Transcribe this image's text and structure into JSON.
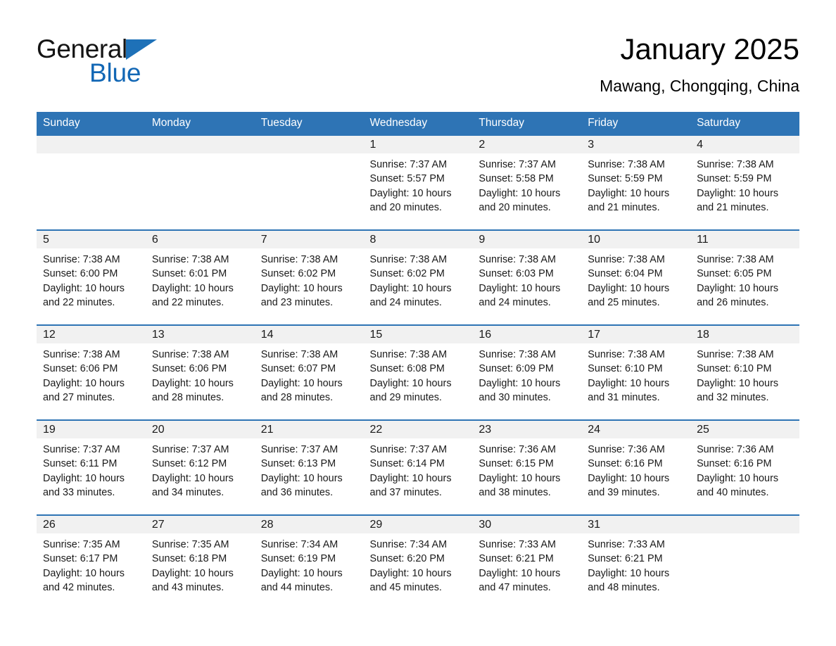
{
  "brand": {
    "name_part1": "General",
    "name_part2": "Blue",
    "triangle_color": "#1e71b8",
    "blue_color": "#1267b5"
  },
  "header": {
    "title": "January 2025",
    "location": "Mawang, Chongqing, China"
  },
  "theme": {
    "header_blue": "#2e74b5",
    "daynum_bg": "#f1f1f1",
    "text": "#1a1a1a"
  },
  "weekday_headers": [
    "Sunday",
    "Monday",
    "Tuesday",
    "Wednesday",
    "Thursday",
    "Friday",
    "Saturday"
  ],
  "weeks": [
    [
      {
        "day": "",
        "sunrise": "",
        "sunset": "",
        "daylight_line1": "",
        "daylight_line2": ""
      },
      {
        "day": "",
        "sunrise": "",
        "sunset": "",
        "daylight_line1": "",
        "daylight_line2": ""
      },
      {
        "day": "",
        "sunrise": "",
        "sunset": "",
        "daylight_line1": "",
        "daylight_line2": ""
      },
      {
        "day": "1",
        "sunrise": "Sunrise: 7:37 AM",
        "sunset": "Sunset: 5:57 PM",
        "daylight_line1": "Daylight: 10 hours",
        "daylight_line2": "and 20 minutes."
      },
      {
        "day": "2",
        "sunrise": "Sunrise: 7:37 AM",
        "sunset": "Sunset: 5:58 PM",
        "daylight_line1": "Daylight: 10 hours",
        "daylight_line2": "and 20 minutes."
      },
      {
        "day": "3",
        "sunrise": "Sunrise: 7:38 AM",
        "sunset": "Sunset: 5:59 PM",
        "daylight_line1": "Daylight: 10 hours",
        "daylight_line2": "and 21 minutes."
      },
      {
        "day": "4",
        "sunrise": "Sunrise: 7:38 AM",
        "sunset": "Sunset: 5:59 PM",
        "daylight_line1": "Daylight: 10 hours",
        "daylight_line2": "and 21 minutes."
      }
    ],
    [
      {
        "day": "5",
        "sunrise": "Sunrise: 7:38 AM",
        "sunset": "Sunset: 6:00 PM",
        "daylight_line1": "Daylight: 10 hours",
        "daylight_line2": "and 22 minutes."
      },
      {
        "day": "6",
        "sunrise": "Sunrise: 7:38 AM",
        "sunset": "Sunset: 6:01 PM",
        "daylight_line1": "Daylight: 10 hours",
        "daylight_line2": "and 22 minutes."
      },
      {
        "day": "7",
        "sunrise": "Sunrise: 7:38 AM",
        "sunset": "Sunset: 6:02 PM",
        "daylight_line1": "Daylight: 10 hours",
        "daylight_line2": "and 23 minutes."
      },
      {
        "day": "8",
        "sunrise": "Sunrise: 7:38 AM",
        "sunset": "Sunset: 6:02 PM",
        "daylight_line1": "Daylight: 10 hours",
        "daylight_line2": "and 24 minutes."
      },
      {
        "day": "9",
        "sunrise": "Sunrise: 7:38 AM",
        "sunset": "Sunset: 6:03 PM",
        "daylight_line1": "Daylight: 10 hours",
        "daylight_line2": "and 24 minutes."
      },
      {
        "day": "10",
        "sunrise": "Sunrise: 7:38 AM",
        "sunset": "Sunset: 6:04 PM",
        "daylight_line1": "Daylight: 10 hours",
        "daylight_line2": "and 25 minutes."
      },
      {
        "day": "11",
        "sunrise": "Sunrise: 7:38 AM",
        "sunset": "Sunset: 6:05 PM",
        "daylight_line1": "Daylight: 10 hours",
        "daylight_line2": "and 26 minutes."
      }
    ],
    [
      {
        "day": "12",
        "sunrise": "Sunrise: 7:38 AM",
        "sunset": "Sunset: 6:06 PM",
        "daylight_line1": "Daylight: 10 hours",
        "daylight_line2": "and 27 minutes."
      },
      {
        "day": "13",
        "sunrise": "Sunrise: 7:38 AM",
        "sunset": "Sunset: 6:06 PM",
        "daylight_line1": "Daylight: 10 hours",
        "daylight_line2": "and 28 minutes."
      },
      {
        "day": "14",
        "sunrise": "Sunrise: 7:38 AM",
        "sunset": "Sunset: 6:07 PM",
        "daylight_line1": "Daylight: 10 hours",
        "daylight_line2": "and 28 minutes."
      },
      {
        "day": "15",
        "sunrise": "Sunrise: 7:38 AM",
        "sunset": "Sunset: 6:08 PM",
        "daylight_line1": "Daylight: 10 hours",
        "daylight_line2": "and 29 minutes."
      },
      {
        "day": "16",
        "sunrise": "Sunrise: 7:38 AM",
        "sunset": "Sunset: 6:09 PM",
        "daylight_line1": "Daylight: 10 hours",
        "daylight_line2": "and 30 minutes."
      },
      {
        "day": "17",
        "sunrise": "Sunrise: 7:38 AM",
        "sunset": "Sunset: 6:10 PM",
        "daylight_line1": "Daylight: 10 hours",
        "daylight_line2": "and 31 minutes."
      },
      {
        "day": "18",
        "sunrise": "Sunrise: 7:38 AM",
        "sunset": "Sunset: 6:10 PM",
        "daylight_line1": "Daylight: 10 hours",
        "daylight_line2": "and 32 minutes."
      }
    ],
    [
      {
        "day": "19",
        "sunrise": "Sunrise: 7:37 AM",
        "sunset": "Sunset: 6:11 PM",
        "daylight_line1": "Daylight: 10 hours",
        "daylight_line2": "and 33 minutes."
      },
      {
        "day": "20",
        "sunrise": "Sunrise: 7:37 AM",
        "sunset": "Sunset: 6:12 PM",
        "daylight_line1": "Daylight: 10 hours",
        "daylight_line2": "and 34 minutes."
      },
      {
        "day": "21",
        "sunrise": "Sunrise: 7:37 AM",
        "sunset": "Sunset: 6:13 PM",
        "daylight_line1": "Daylight: 10 hours",
        "daylight_line2": "and 36 minutes."
      },
      {
        "day": "22",
        "sunrise": "Sunrise: 7:37 AM",
        "sunset": "Sunset: 6:14 PM",
        "daylight_line1": "Daylight: 10 hours",
        "daylight_line2": "and 37 minutes."
      },
      {
        "day": "23",
        "sunrise": "Sunrise: 7:36 AM",
        "sunset": "Sunset: 6:15 PM",
        "daylight_line1": "Daylight: 10 hours",
        "daylight_line2": "and 38 minutes."
      },
      {
        "day": "24",
        "sunrise": "Sunrise: 7:36 AM",
        "sunset": "Sunset: 6:16 PM",
        "daylight_line1": "Daylight: 10 hours",
        "daylight_line2": "and 39 minutes."
      },
      {
        "day": "25",
        "sunrise": "Sunrise: 7:36 AM",
        "sunset": "Sunset: 6:16 PM",
        "daylight_line1": "Daylight: 10 hours",
        "daylight_line2": "and 40 minutes."
      }
    ],
    [
      {
        "day": "26",
        "sunrise": "Sunrise: 7:35 AM",
        "sunset": "Sunset: 6:17 PM",
        "daylight_line1": "Daylight: 10 hours",
        "daylight_line2": "and 42 minutes."
      },
      {
        "day": "27",
        "sunrise": "Sunrise: 7:35 AM",
        "sunset": "Sunset: 6:18 PM",
        "daylight_line1": "Daylight: 10 hours",
        "daylight_line2": "and 43 minutes."
      },
      {
        "day": "28",
        "sunrise": "Sunrise: 7:34 AM",
        "sunset": "Sunset: 6:19 PM",
        "daylight_line1": "Daylight: 10 hours",
        "daylight_line2": "and 44 minutes."
      },
      {
        "day": "29",
        "sunrise": "Sunrise: 7:34 AM",
        "sunset": "Sunset: 6:20 PM",
        "daylight_line1": "Daylight: 10 hours",
        "daylight_line2": "and 45 minutes."
      },
      {
        "day": "30",
        "sunrise": "Sunrise: 7:33 AM",
        "sunset": "Sunset: 6:21 PM",
        "daylight_line1": "Daylight: 10 hours",
        "daylight_line2": "and 47 minutes."
      },
      {
        "day": "31",
        "sunrise": "Sunrise: 7:33 AM",
        "sunset": "Sunset: 6:21 PM",
        "daylight_line1": "Daylight: 10 hours",
        "daylight_line2": "and 48 minutes."
      },
      {
        "day": "",
        "sunrise": "",
        "sunset": "",
        "daylight_line1": "",
        "daylight_line2": ""
      }
    ]
  ]
}
